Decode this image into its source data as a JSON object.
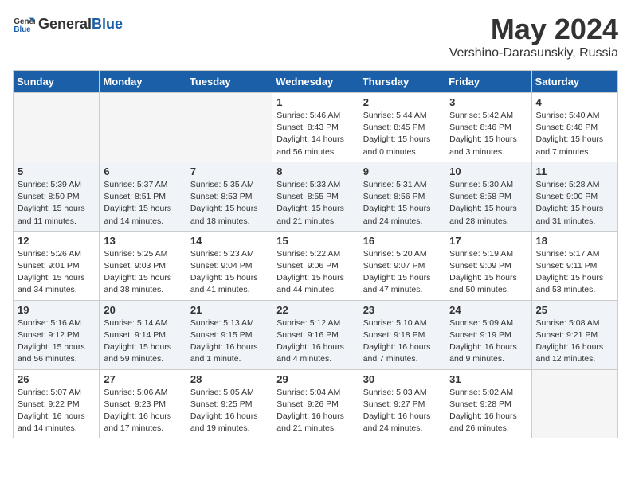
{
  "logo": {
    "general": "General",
    "blue": "Blue"
  },
  "title": "May 2024",
  "location": "Vershino-Darasunskiy, Russia",
  "days_of_week": [
    "Sunday",
    "Monday",
    "Tuesday",
    "Wednesday",
    "Thursday",
    "Friday",
    "Saturday"
  ],
  "weeks": [
    [
      {
        "day": "",
        "info": ""
      },
      {
        "day": "",
        "info": ""
      },
      {
        "day": "",
        "info": ""
      },
      {
        "day": "1",
        "info": "Sunrise: 5:46 AM\nSunset: 8:43 PM\nDaylight: 14 hours\nand 56 minutes."
      },
      {
        "day": "2",
        "info": "Sunrise: 5:44 AM\nSunset: 8:45 PM\nDaylight: 15 hours\nand 0 minutes."
      },
      {
        "day": "3",
        "info": "Sunrise: 5:42 AM\nSunset: 8:46 PM\nDaylight: 15 hours\nand 3 minutes."
      },
      {
        "day": "4",
        "info": "Sunrise: 5:40 AM\nSunset: 8:48 PM\nDaylight: 15 hours\nand 7 minutes."
      }
    ],
    [
      {
        "day": "5",
        "info": "Sunrise: 5:39 AM\nSunset: 8:50 PM\nDaylight: 15 hours\nand 11 minutes."
      },
      {
        "day": "6",
        "info": "Sunrise: 5:37 AM\nSunset: 8:51 PM\nDaylight: 15 hours\nand 14 minutes."
      },
      {
        "day": "7",
        "info": "Sunrise: 5:35 AM\nSunset: 8:53 PM\nDaylight: 15 hours\nand 18 minutes."
      },
      {
        "day": "8",
        "info": "Sunrise: 5:33 AM\nSunset: 8:55 PM\nDaylight: 15 hours\nand 21 minutes."
      },
      {
        "day": "9",
        "info": "Sunrise: 5:31 AM\nSunset: 8:56 PM\nDaylight: 15 hours\nand 24 minutes."
      },
      {
        "day": "10",
        "info": "Sunrise: 5:30 AM\nSunset: 8:58 PM\nDaylight: 15 hours\nand 28 minutes."
      },
      {
        "day": "11",
        "info": "Sunrise: 5:28 AM\nSunset: 9:00 PM\nDaylight: 15 hours\nand 31 minutes."
      }
    ],
    [
      {
        "day": "12",
        "info": "Sunrise: 5:26 AM\nSunset: 9:01 PM\nDaylight: 15 hours\nand 34 minutes."
      },
      {
        "day": "13",
        "info": "Sunrise: 5:25 AM\nSunset: 9:03 PM\nDaylight: 15 hours\nand 38 minutes."
      },
      {
        "day": "14",
        "info": "Sunrise: 5:23 AM\nSunset: 9:04 PM\nDaylight: 15 hours\nand 41 minutes."
      },
      {
        "day": "15",
        "info": "Sunrise: 5:22 AM\nSunset: 9:06 PM\nDaylight: 15 hours\nand 44 minutes."
      },
      {
        "day": "16",
        "info": "Sunrise: 5:20 AM\nSunset: 9:07 PM\nDaylight: 15 hours\nand 47 minutes."
      },
      {
        "day": "17",
        "info": "Sunrise: 5:19 AM\nSunset: 9:09 PM\nDaylight: 15 hours\nand 50 minutes."
      },
      {
        "day": "18",
        "info": "Sunrise: 5:17 AM\nSunset: 9:11 PM\nDaylight: 15 hours\nand 53 minutes."
      }
    ],
    [
      {
        "day": "19",
        "info": "Sunrise: 5:16 AM\nSunset: 9:12 PM\nDaylight: 15 hours\nand 56 minutes."
      },
      {
        "day": "20",
        "info": "Sunrise: 5:14 AM\nSunset: 9:14 PM\nDaylight: 15 hours\nand 59 minutes."
      },
      {
        "day": "21",
        "info": "Sunrise: 5:13 AM\nSunset: 9:15 PM\nDaylight: 16 hours\nand 1 minute."
      },
      {
        "day": "22",
        "info": "Sunrise: 5:12 AM\nSunset: 9:16 PM\nDaylight: 16 hours\nand 4 minutes."
      },
      {
        "day": "23",
        "info": "Sunrise: 5:10 AM\nSunset: 9:18 PM\nDaylight: 16 hours\nand 7 minutes."
      },
      {
        "day": "24",
        "info": "Sunrise: 5:09 AM\nSunset: 9:19 PM\nDaylight: 16 hours\nand 9 minutes."
      },
      {
        "day": "25",
        "info": "Sunrise: 5:08 AM\nSunset: 9:21 PM\nDaylight: 16 hours\nand 12 minutes."
      }
    ],
    [
      {
        "day": "26",
        "info": "Sunrise: 5:07 AM\nSunset: 9:22 PM\nDaylight: 16 hours\nand 14 minutes."
      },
      {
        "day": "27",
        "info": "Sunrise: 5:06 AM\nSunset: 9:23 PM\nDaylight: 16 hours\nand 17 minutes."
      },
      {
        "day": "28",
        "info": "Sunrise: 5:05 AM\nSunset: 9:25 PM\nDaylight: 16 hours\nand 19 minutes."
      },
      {
        "day": "29",
        "info": "Sunrise: 5:04 AM\nSunset: 9:26 PM\nDaylight: 16 hours\nand 21 minutes."
      },
      {
        "day": "30",
        "info": "Sunrise: 5:03 AM\nSunset: 9:27 PM\nDaylight: 16 hours\nand 24 minutes."
      },
      {
        "day": "31",
        "info": "Sunrise: 5:02 AM\nSunset: 9:28 PM\nDaylight: 16 hours\nand 26 minutes."
      },
      {
        "day": "",
        "info": ""
      }
    ]
  ]
}
